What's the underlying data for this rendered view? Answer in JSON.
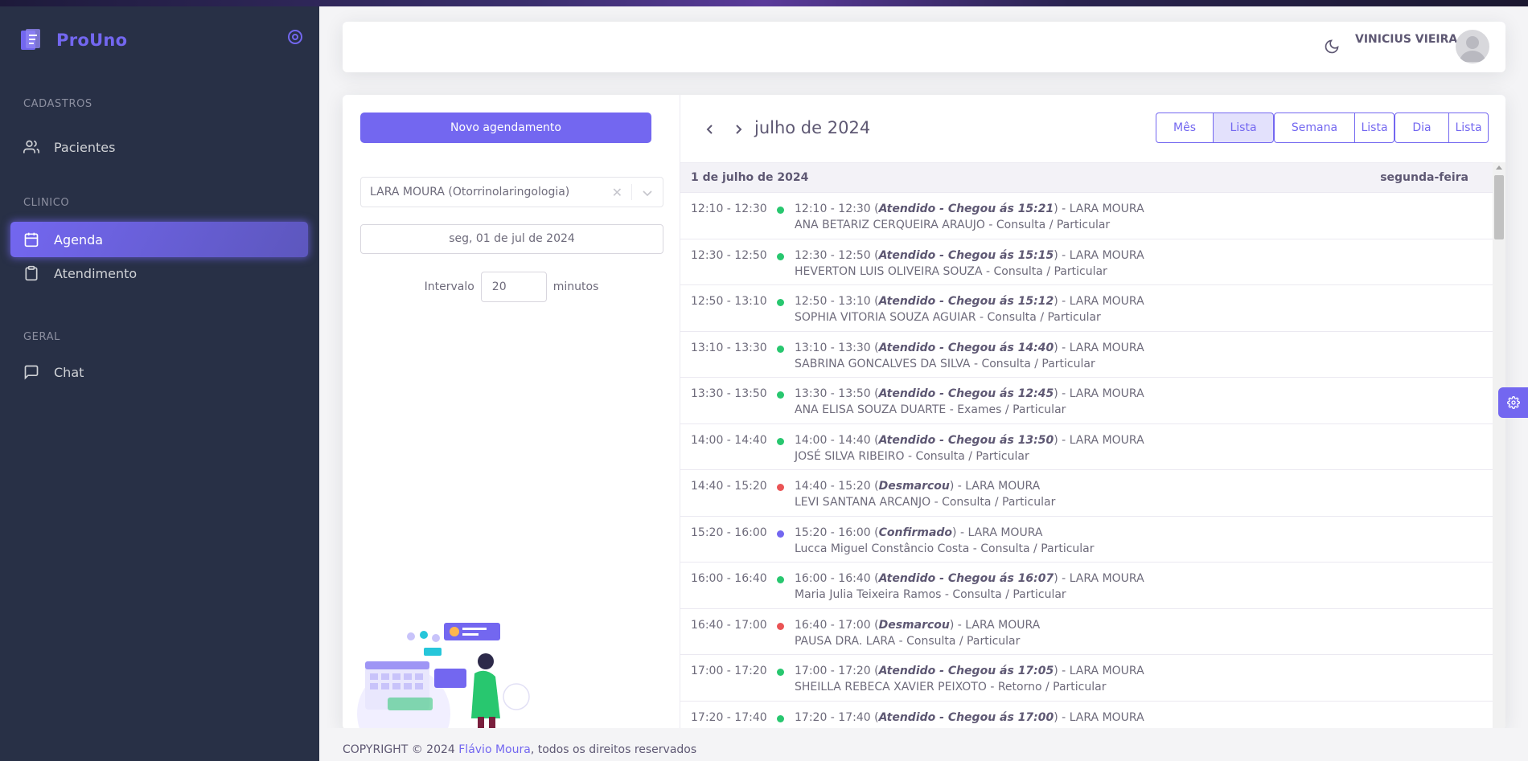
{
  "app": {
    "name": "ProUno",
    "brand_color": "#7367f0"
  },
  "sidebar": {
    "sections": [
      {
        "title": "CADASTROS",
        "items": [
          {
            "label": "Pacientes",
            "icon": "users-icon"
          }
        ]
      },
      {
        "title": "CLINICO",
        "items": [
          {
            "label": "Agenda",
            "icon": "calendar-icon",
            "active": true
          },
          {
            "label": "Atendimento",
            "icon": "clipboard-icon"
          }
        ]
      },
      {
        "title": "GERAL",
        "items": [
          {
            "label": "Chat",
            "icon": "message-square-icon"
          }
        ]
      }
    ]
  },
  "header": {
    "user_name": "VINICIUS VIEIRA"
  },
  "left_panel": {
    "new_button": "Novo agendamento",
    "doctor_select": "LARA MOURA (Otorrinolaringologia)",
    "date_value": "seg, 01 de jul de 2024",
    "interval_label": "Intervalo",
    "interval_value": "20",
    "interval_unit": "minutos"
  },
  "calendar": {
    "title": "julho de 2024",
    "views": [
      "Mês",
      "Lista",
      "Semana",
      "Lista",
      "Dia",
      "Lista"
    ],
    "active_view_index": 1,
    "day_header": {
      "date": "1 de julho de 2024",
      "weekday": "segunda-feira"
    },
    "status_colors": {
      "attended": "#28c76f",
      "cancelled": "#ea5455",
      "confirmed": "#7367f0"
    },
    "events": [
      {
        "time": "12:10 - 12:30",
        "range": "12:10 - 12:30",
        "status": "Atendido - Chegou ás 15:21",
        "color": "attended",
        "doctor": "LARA MOURA",
        "patient": "ANA BETARIZ CERQUEIRA ARAUJO - Consulta / Particular"
      },
      {
        "time": "12:30 - 12:50",
        "range": "12:30 - 12:50",
        "status": "Atendido - Chegou ás 15:15",
        "color": "attended",
        "doctor": "LARA MOURA",
        "patient": "HEVERTON LUIS OLIVEIRA SOUZA - Consulta / Particular"
      },
      {
        "time": "12:50 - 13:10",
        "range": "12:50 - 13:10",
        "status": "Atendido - Chegou ás 15:12",
        "color": "attended",
        "doctor": "LARA MOURA",
        "patient": "SOPHIA VITORIA SOUZA AGUIAR - Consulta / Particular"
      },
      {
        "time": "13:10 - 13:30",
        "range": "13:10 - 13:30",
        "status": "Atendido - Chegou ás 14:40",
        "color": "attended",
        "doctor": "LARA MOURA",
        "patient": "SABRINA GONCALVES DA SILVA - Consulta / Particular"
      },
      {
        "time": "13:30 - 13:50",
        "range": "13:30 - 13:50",
        "status": "Atendido - Chegou ás 12:45",
        "color": "attended",
        "doctor": "LARA MOURA",
        "patient": "ANA ELISA SOUZA DUARTE - Exames / Particular"
      },
      {
        "time": "14:00 - 14:40",
        "range": "14:00 - 14:40",
        "status": "Atendido - Chegou ás 13:50",
        "color": "attended",
        "doctor": "LARA MOURA",
        "patient": "JOSÉ SILVA RIBEIRO - Consulta / Particular"
      },
      {
        "time": "14:40 - 15:20",
        "range": "14:40 - 15:20",
        "status": "Desmarcou",
        "color": "cancelled",
        "doctor": "LARA MOURA",
        "patient": "LEVI SANTANA ARCANJO - Consulta / Particular"
      },
      {
        "time": "15:20 - 16:00",
        "range": "15:20 - 16:00",
        "status": "Confirmado",
        "color": "confirmed",
        "doctor": "LARA MOURA",
        "patient": "Lucca Miguel Constâncio Costa - Consulta / Particular"
      },
      {
        "time": "16:00 - 16:40",
        "range": "16:00 - 16:40",
        "status": "Atendido - Chegou ás 16:07",
        "color": "attended",
        "doctor": "LARA MOURA",
        "patient": "Maria Julia Teixeira Ramos - Consulta / Particular"
      },
      {
        "time": "16:40 - 17:00",
        "range": "16:40 - 17:00",
        "status": "Desmarcou",
        "color": "cancelled",
        "doctor": "LARA MOURA",
        "patient": "PAUSA DRA. LARA - Consulta / Particular"
      },
      {
        "time": "17:00 - 17:20",
        "range": "17:00 - 17:20",
        "status": "Atendido - Chegou ás 17:05",
        "color": "attended",
        "doctor": "LARA MOURA",
        "patient": "SHEILLA REBECA XAVIER PEIXOTO - Retorno / Particular"
      },
      {
        "time": "17:20 - 17:40",
        "range": "17:20 - 17:40",
        "status": "Atendido - Chegou ás 17:00",
        "color": "attended",
        "doctor": "LARA MOURA",
        "patient": ""
      }
    ]
  },
  "footer": {
    "prefix": "COPYRIGHT © 2024 ",
    "author": "Flávio Moura",
    "suffix": ", todos os direitos reservados"
  }
}
